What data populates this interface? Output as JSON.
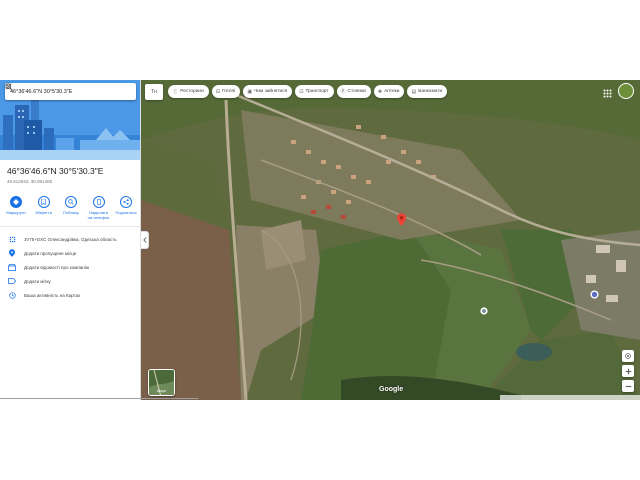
{
  "search": {
    "query": "46°36'46.6\"N 30°5'30.3\"E"
  },
  "place": {
    "title": "46°36'46.6\"N 30°5'30.3\"E",
    "coords": "46.612942, 30.091405"
  },
  "actions": [
    {
      "label": "Маршрути",
      "icon": "directions-icon"
    },
    {
      "label": "Зберегти",
      "icon": "bookmark-icon"
    },
    {
      "label": "Поблизу",
      "icon": "nearby-icon"
    },
    {
      "label": "Надіслати на телефон",
      "icon": "phone-icon"
    },
    {
      "label": "Поділитися",
      "icon": "share-icon"
    }
  ],
  "info_items": [
    {
      "text": "JV75+DXC Олександрівка, Одеська область",
      "icon": "plus-code-icon"
    },
    {
      "text": "Додати пропущене місце",
      "icon": "add-place-icon"
    },
    {
      "text": "Додати відомості про компанію",
      "icon": "business-icon"
    },
    {
      "text": "Додати мітку",
      "icon": "label-icon"
    },
    {
      "text": "Ваша активність на Картах",
      "icon": "history-icon"
    }
  ],
  "map": {
    "lang_label": "Тн",
    "chips": [
      {
        "label": "Ресторани",
        "icon": "restaurant-icon"
      },
      {
        "label": "Готелі",
        "icon": "hotel-icon"
      },
      {
        "label": "Чим зайнятися",
        "icon": "things-to-do-icon"
      },
      {
        "label": "Транспорт",
        "icon": "transit-icon"
      },
      {
        "label": "Стоянки",
        "icon": "parking-icon"
      },
      {
        "label": "Аптеки",
        "icon": "pharmacy-icon"
      },
      {
        "label": "Банкомати",
        "icon": "atm-icon"
      }
    ],
    "layers_label": "Шари",
    "logo": "Google"
  },
  "colors": {
    "accent": "#1a73e8",
    "pin": "#ea4335",
    "hero": "#3f8fe0"
  }
}
